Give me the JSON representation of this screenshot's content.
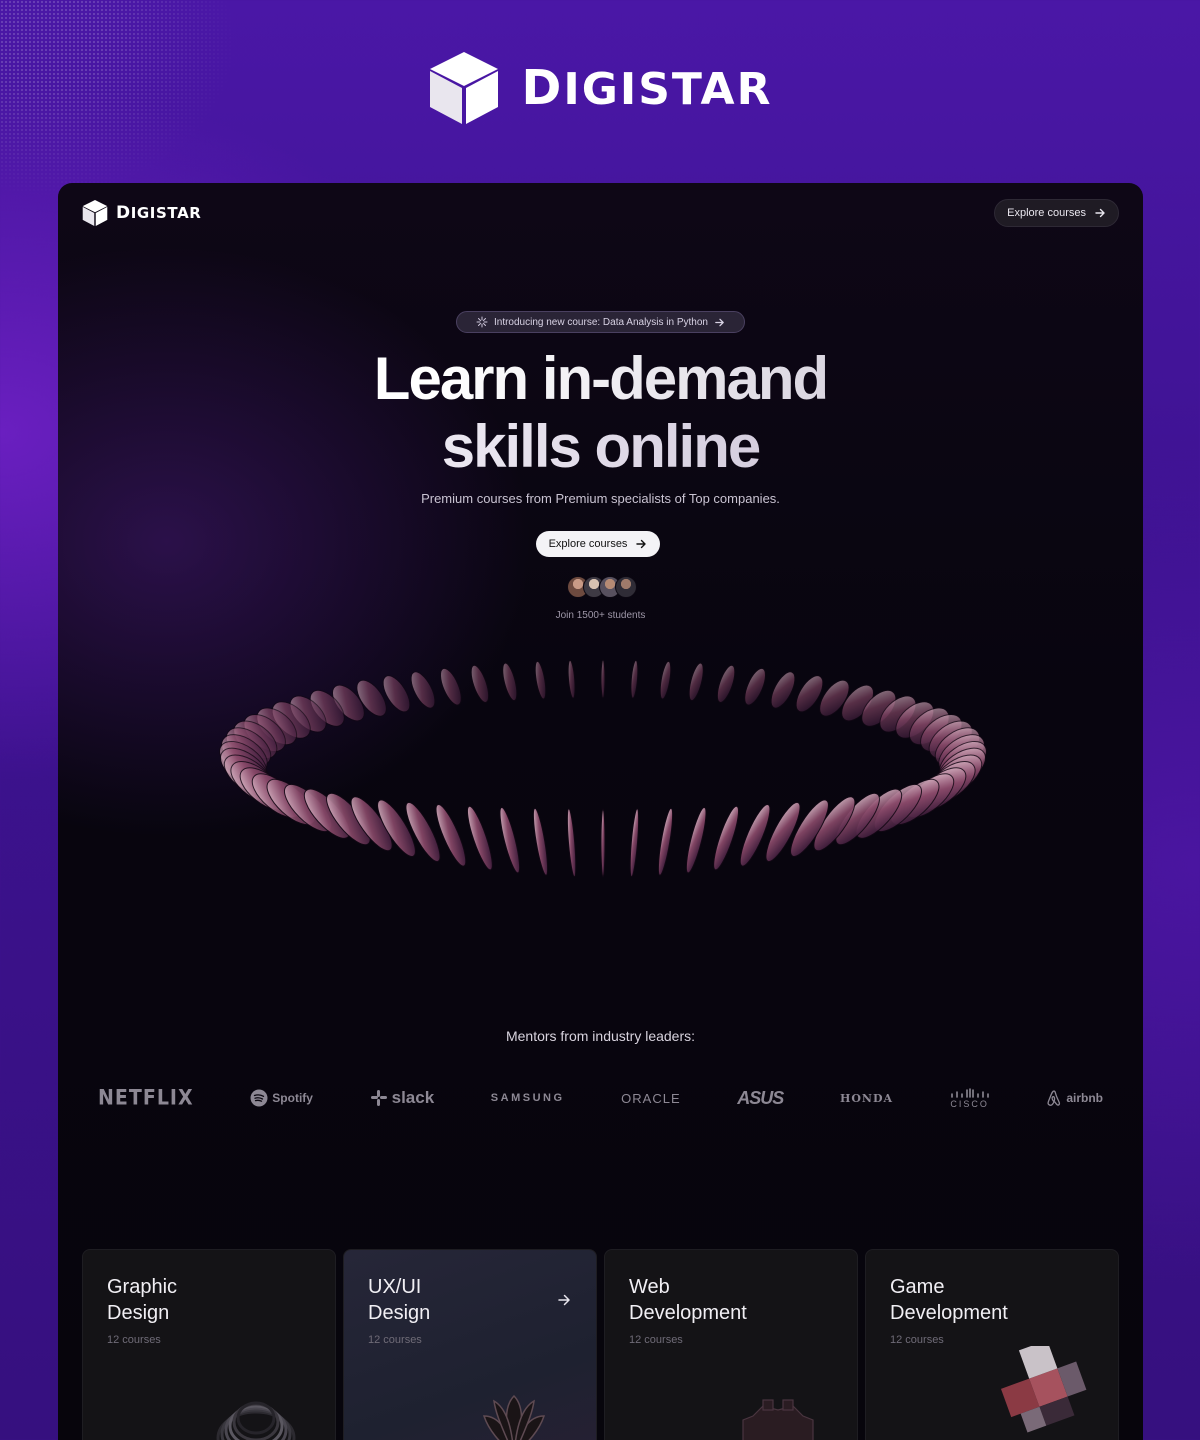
{
  "brand": {
    "name_initial": "D",
    "name_rest": "IGISTAR"
  },
  "nav": {
    "explore_label": "Explore courses"
  },
  "announcement": {
    "text": "Introducing new course: Data Analysis in Python"
  },
  "hero": {
    "title_line1": "Learn in-demand",
    "title_line2": "skills online",
    "subtitle": "Premium courses from Premium specialists of Top companies.",
    "cta_label": "Explore courses",
    "join_text": "Join 1500+ students"
  },
  "mentors": {
    "heading": "Mentors from industry leaders:",
    "logos": [
      "NETFLIX",
      "Spotify",
      "slack",
      "SAMSUNG",
      "ORACLE",
      "ASUS",
      "HONDA",
      "CISCO",
      "airbnb"
    ]
  },
  "courses": [
    {
      "title_line1": "Graphic",
      "title_line2": "Design",
      "count": "12 courses"
    },
    {
      "title_line1": "UX/UI",
      "title_line2": "Design",
      "count": "12 courses"
    },
    {
      "title_line1": "Web",
      "title_line2": "Development",
      "count": "12 courses"
    },
    {
      "title_line1": "Game",
      "title_line2": "Development",
      "count": "12 courses"
    }
  ],
  "colors": {
    "background": "#3d1290",
    "frame": "#08050f",
    "accent_glow": "#6a1fc0"
  }
}
